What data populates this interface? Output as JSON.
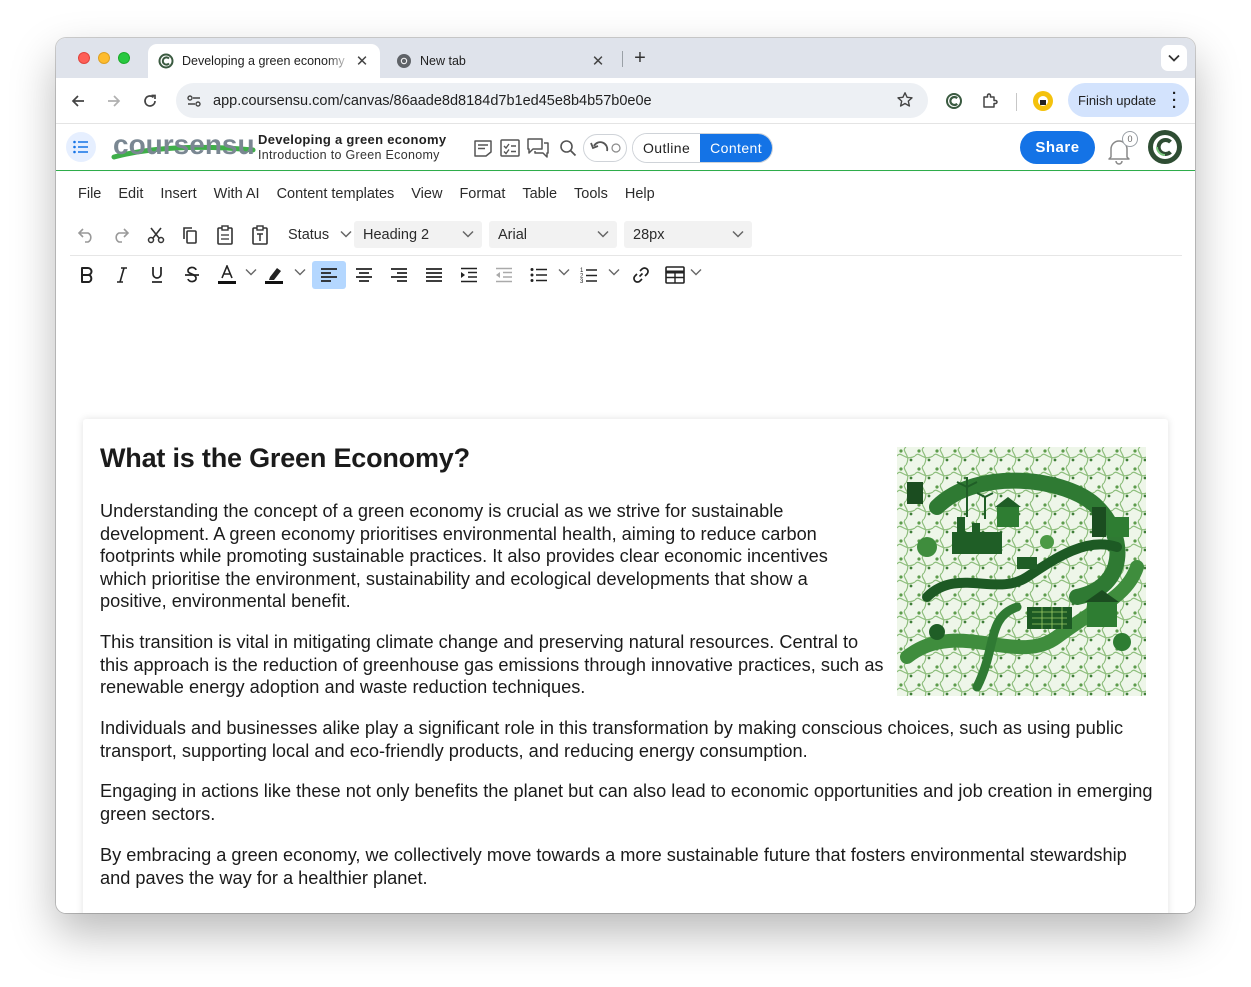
{
  "browser": {
    "active_tab_title": "Developing a green economy",
    "inactive_tab_title": "New tab",
    "url": "app.coursensu.com/canvas/86aade8d8184d7b1ed45e8b4b57b0e0e",
    "finish_update_label": "Finish update"
  },
  "app": {
    "logo_text": "coursensu.",
    "course_title": "Developing a green economy",
    "course_subtitle": "Introduction to Green Economy",
    "outline_label": "Outline",
    "content_label": "Content",
    "share_label": "Share",
    "notification_count": "0"
  },
  "editor": {
    "menus": [
      "File",
      "Edit",
      "Insert",
      "With AI",
      "Content templates",
      "View",
      "Format",
      "Table",
      "Tools",
      "Help"
    ],
    "status_label": "Status",
    "block_format": "Heading 2",
    "font_family": "Arial",
    "font_size": "28px"
  },
  "document": {
    "title": "What is the Green Economy?",
    "paragraphs": [
      "Understanding the concept of a green economy is crucial as we strive for sustainable development. A green economy prioritises environmental health, aiming to reduce carbon footprints while promoting sustainable practices. It also provides clear economic incentives which prioritise the environment, sustainability and ecological developments that show a positive, environmental benefit.",
      "This transition is vital in mitigating climate change and preserving natural resources. Central to this approach is the reduction of greenhouse gas emissions through innovative practices, such as renewable energy adoption and waste reduction techniques.",
      "Individuals and businesses alike play a significant role in this transformation by making conscious choices, such as using public transport, supporting local and eco-friendly products, and reducing energy consumption.",
      "Engaging in actions like these not only benefits the planet but can also lead to economic opportunities and job creation in emerging green sectors.",
      "By embracing a green economy, we collectively move towards a more sustainable future that fosters environmental stewardship and paves the way for a healthier planet."
    ]
  },
  "colors": {
    "accent_blue": "#1473e6",
    "brand_green": "#2fae4b",
    "active_align_bg": "#b4d7ff"
  }
}
